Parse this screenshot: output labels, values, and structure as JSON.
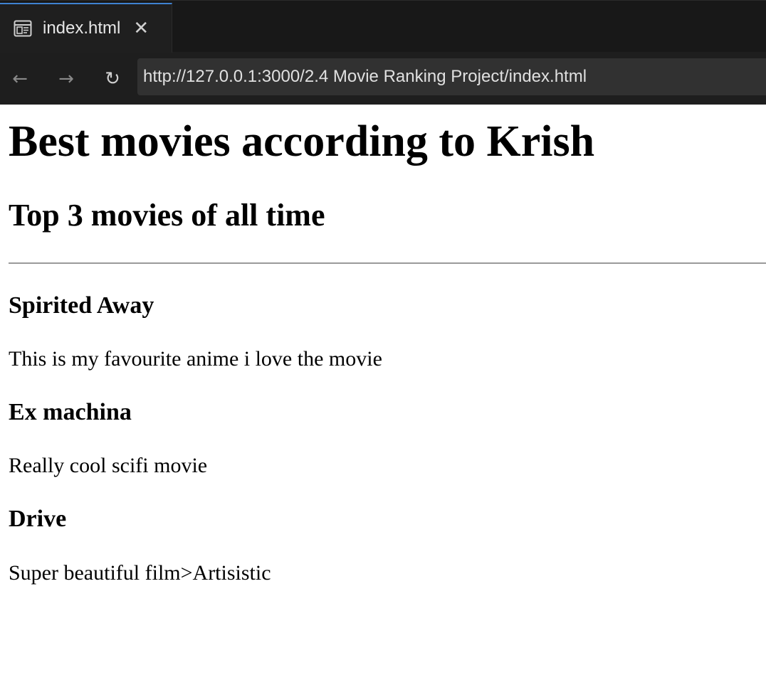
{
  "browser": {
    "tab": {
      "label": "index.html",
      "icon": "preview-icon"
    },
    "nav": {
      "back": "←",
      "forward": "→",
      "reload": "↻"
    },
    "url": "http://127.0.0.1:3000/2.4 Movie Ranking Project/index.html"
  },
  "page": {
    "title": "Best movies according to Krish",
    "subtitle": "Top 3 movies of all time",
    "movies": [
      {
        "title": "Spirited Away",
        "description": "This is my favourite anime i love the movie"
      },
      {
        "title": "Ex machina",
        "description": "Really cool scifi movie"
      },
      {
        "title": "Drive",
        "description": "Super beautiful film>Artisistic"
      }
    ]
  },
  "colors": {
    "chrome_bg": "#1e1e1e",
    "tab_accent": "#3f82d1",
    "address_bg": "#313131",
    "page_bg": "#ffffff"
  }
}
